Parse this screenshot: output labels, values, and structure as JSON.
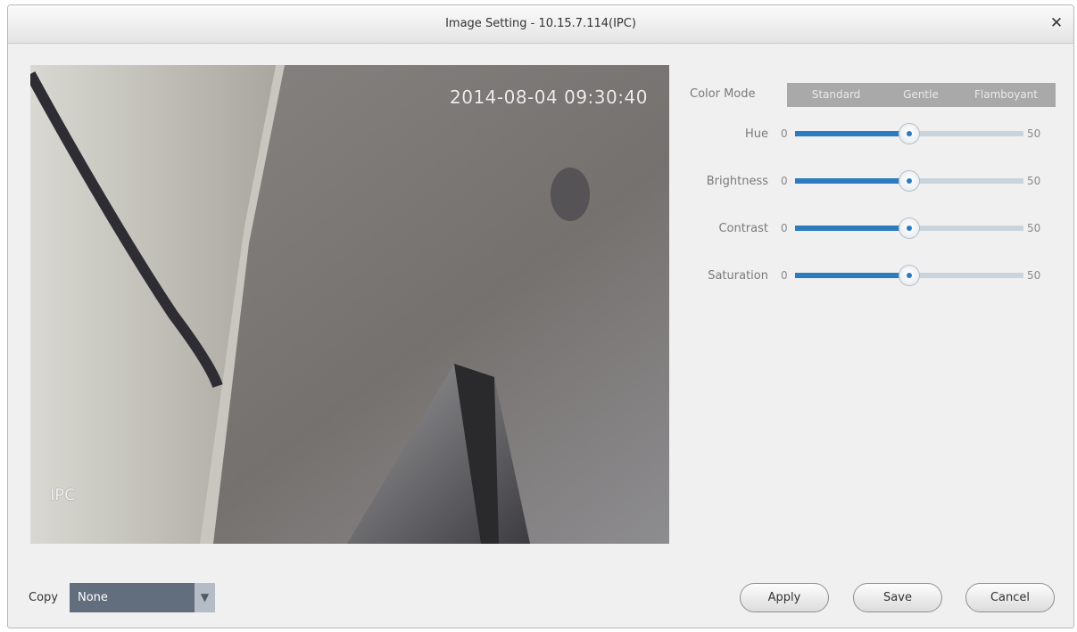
{
  "window": {
    "title": "Image Setting - 10.15.7.114(IPC)",
    "close_icon": "close-icon"
  },
  "video": {
    "timestamp": "2014-08-04 09:30:40",
    "camera_label": "IPC"
  },
  "color_mode": {
    "label": "Color Mode",
    "options": [
      "Standard",
      "Gentle",
      "Flamboyant"
    ]
  },
  "sliders": [
    {
      "label": "Hue",
      "min": "0",
      "max": "50",
      "value_fraction": 0.5
    },
    {
      "label": "Brightness",
      "min": "0",
      "max": "50",
      "value_fraction": 0.5
    },
    {
      "label": "Contrast",
      "min": "0",
      "max": "50",
      "value_fraction": 0.5
    },
    {
      "label": "Saturation",
      "min": "0",
      "max": "50",
      "value_fraction": 0.5
    }
  ],
  "copy": {
    "label": "Copy",
    "selected": "None",
    "arrow_icon": "triangle-down-icon"
  },
  "buttons": {
    "apply": "Apply",
    "save": "Save",
    "cancel": "Cancel"
  },
  "colors": {
    "accent": "#2c7bc0",
    "mode_bar": "#a9a9a9",
    "select_bg": "#626d7d"
  }
}
